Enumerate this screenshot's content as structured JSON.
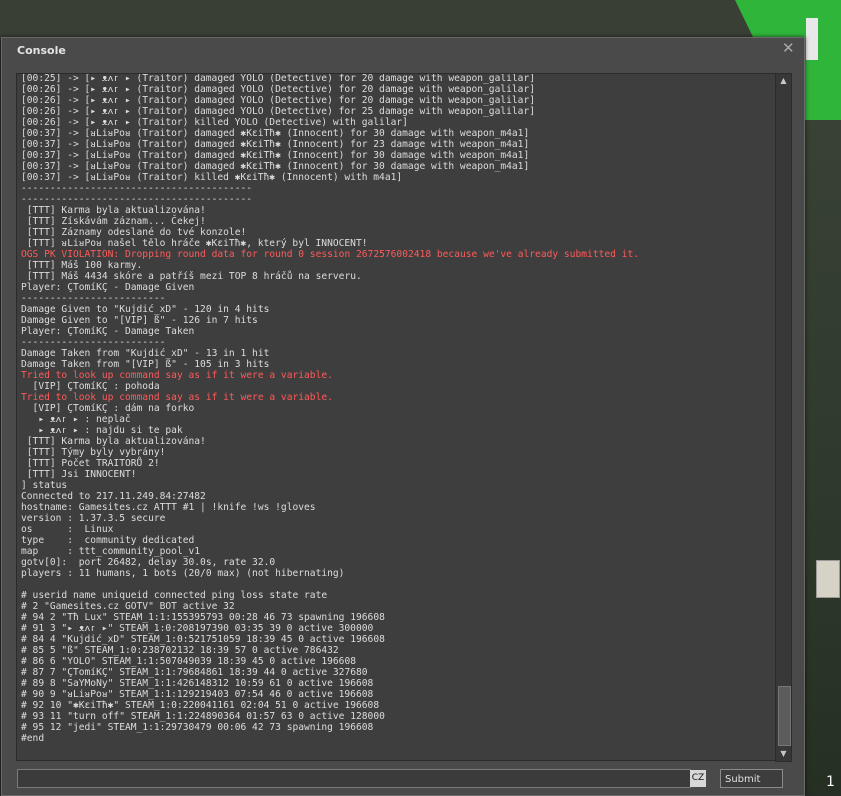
{
  "window": {
    "title": "Console",
    "close_glyph": "✕"
  },
  "colors": {
    "error": "#ff5a5a",
    "text": "#dcdcdc"
  },
  "console_lines": [
    {
      "text": "[00:25] -> [▸ ᴥᴧᴦ ▸ (Traitor) damaged YOLO (Detective) for 20 damage with weapon_galilar]",
      "type": "normal"
    },
    {
      "text": "[00:26] -> [▸ ᴥᴧᴦ ▸ (Traitor) damaged YOLO (Detective) for 20 damage with weapon_galilar]",
      "type": "normal"
    },
    {
      "text": "[00:26] -> [▸ ᴥᴧᴦ ▸ (Traitor) damaged YOLO (Detective) for 20 damage with weapon_galilar]",
      "type": "normal"
    },
    {
      "text": "[00:26] -> [▸ ᴥᴧᴦ ▸ (Traitor) damaged YOLO (Detective) for 25 damage with weapon_galilar]",
      "type": "normal"
    },
    {
      "text": "[00:26] -> [▸ ᴥᴧᴦ ▸ (Traitor) killed YOLO (Detective) with galilar]",
      "type": "normal"
    },
    {
      "text": "[00:37] -> [ᴚLiᴚPoᴚ (Traitor) damaged ✱KɛiTħ✱ (Innocent) for 30 damage with weapon_m4a1]",
      "type": "normal"
    },
    {
      "text": "[00:37] -> [ᴚLiᴚPoᴚ (Traitor) damaged ✱KɛiTħ✱ (Innocent) for 23 damage with weapon_m4a1]",
      "type": "normal"
    },
    {
      "text": "[00:37] -> [ᴚLiᴚPoᴚ (Traitor) damaged ✱KɛiTħ✱ (Innocent) for 30 damage with weapon_m4a1]",
      "type": "normal"
    },
    {
      "text": "[00:37] -> [ᴚLiᴚPoᴚ (Traitor) damaged ✱KɛiTħ✱ (Innocent) for 30 damage with weapon_m4a1]",
      "type": "normal"
    },
    {
      "text": "[00:37] -> [ᴚLiᴚPoᴚ (Traitor) killed ✱KɛiTħ✱ (Innocent) with m4a1]",
      "type": "normal"
    },
    {
      "text": "----------------------------------------",
      "type": "normal"
    },
    {
      "text": "----------------------------------------",
      "type": "normal"
    },
    {
      "text": " [TTT] Karma byla aktualizována!",
      "type": "normal"
    },
    {
      "text": " [TTT] Získávám záznam... Čekej!",
      "type": "normal"
    },
    {
      "text": " [TTT] Záznamy odeslané do tvé konzole!",
      "type": "normal"
    },
    {
      "text": " [TTT] ᴚLiᴚPoᴚ našel tělo hráče ✱KɛiTħ✱, který byl INNOCENT!",
      "type": "normal"
    },
    {
      "text": "OGS PK VIOLATION: Dropping round data for round 0 session 2672576002418 because we've already submitted it.",
      "type": "error"
    },
    {
      "text": " [TTT] Máš 100 karmy.",
      "type": "normal"
    },
    {
      "text": " [TTT] Máš 4434 skóre a patříš mezi TOP 8 hráčů na serveru.",
      "type": "normal"
    },
    {
      "text": "Player: ÇTomíKÇ - Damage Given",
      "type": "normal"
    },
    {
      "text": "-------------------------",
      "type": "normal"
    },
    {
      "text": "Damage Given to \"Kujdić_xD\" - 120 in 4 hits",
      "type": "normal"
    },
    {
      "text": "Damage Given to \"[VIP] ß\" - 126 in 7 hits",
      "type": "normal"
    },
    {
      "text": "Player: ÇTomíKÇ - Damage Taken",
      "type": "normal"
    },
    {
      "text": "-------------------------",
      "type": "normal"
    },
    {
      "text": "Damage Taken from \"Kujdić_xD\" - 13 in 1 hit",
      "type": "normal"
    },
    {
      "text": "Damage Taken from \"[VIP] ß\" - 105 in 3 hits",
      "type": "normal"
    },
    {
      "text": "Tried to look up command say as if it were a variable.",
      "type": "error"
    },
    {
      "text": "  [VIP] ÇTomíKÇ : pohoda",
      "type": "normal"
    },
    {
      "text": "Tried to look up command say as if it were a variable.",
      "type": "error"
    },
    {
      "text": "  [VIP] ÇTomíKÇ : dám na forko",
      "type": "normal"
    },
    {
      "text": "   ▸ ᴥᴧᴦ ▸ : neplač",
      "type": "normal"
    },
    {
      "text": "   ▸ ᴥᴧᴦ ▸ : najdu si te pak",
      "type": "normal"
    },
    {
      "text": " [TTT] Karma byla aktualizována!",
      "type": "normal"
    },
    {
      "text": " [TTT] Týmy byly vybrány!",
      "type": "normal"
    },
    {
      "text": " [TTT] Počet TRAITORŮ 2!",
      "type": "normal"
    },
    {
      "text": " [TTT] Jsi INNOCENT!",
      "type": "normal"
    },
    {
      "text": "] status",
      "type": "normal"
    },
    {
      "text": "Connected to 217.11.249.84:27482",
      "type": "normal"
    },
    {
      "text": "hostname: Gamesites.cz ATTT #1 | !knife !ws !gloves",
      "type": "normal"
    },
    {
      "text": "version : 1.37.3.5 secure",
      "type": "normal"
    },
    {
      "text": "os      :  Linux",
      "type": "normal"
    },
    {
      "text": "type    :  community dedicated",
      "type": "normal"
    },
    {
      "text": "map     : ttt_community_pool_v1",
      "type": "normal"
    },
    {
      "text": "gotv[0]:  port 26482, delay 30.0s, rate 32.0",
      "type": "normal"
    },
    {
      "text": "players : 11 humans, 1 bots (20/0 max) (not hibernating)",
      "type": "normal"
    },
    {
      "text": "",
      "type": "normal"
    },
    {
      "text": "# userid name uniqueid connected ping loss state rate",
      "type": "normal"
    },
    {
      "text": "# 2 \"Gamesites.cz GOTV\" BOT active 32",
      "type": "normal"
    },
    {
      "text": "# 94 2 \"Tħ Lux\" STEAM_1:1:155395793 00:28 46 73 spawning 196608",
      "type": "normal"
    },
    {
      "text": "# 91 3 \"▸ ᴥᴧᴦ ▸\" STEAM_1:0:208197390 03:35 39 0 active 300000",
      "type": "normal"
    },
    {
      "text": "# 84 4 \"Kujdić_xD\" STEAM_1:0:521751059 18:39 45 0 active 196608",
      "type": "normal"
    },
    {
      "text": "# 85 5 \"ß\" STEAM_1:0:238702132 18:39 57 0 active 786432",
      "type": "normal"
    },
    {
      "text": "# 86 6 \"YOLO\" STEAM_1:1:507049039 18:39 45 0 active 196608",
      "type": "normal"
    },
    {
      "text": "# 87 7 \"ÇTomíKÇ\" STEAM_1:1:79684861 18:39 44 0 active 327680",
      "type": "normal"
    },
    {
      "text": "# 89 8 \"SaYMoNy\" STEAM_1:1:426148312 10:59 61 0 active 196608",
      "type": "normal"
    },
    {
      "text": "# 90 9 \"ᴚLiᴚPoᴚ\" STEAM_1:1:129219403 07:54 46 0 active 196608",
      "type": "normal"
    },
    {
      "text": "# 92 10 \"✱KɛiTħ✱\" STEAM_1:0:220041161 02:04 51 0 active 196608",
      "type": "normal"
    },
    {
      "text": "# 93 11 \"turn off\" STEAM_1:1:224890364 01:57 63 0 active 128000",
      "type": "normal"
    },
    {
      "text": "# 95 12 \"jedi\" STEAM_1:1:29730479 00:06 42 73 spawning 196608",
      "type": "normal"
    },
    {
      "text": "#end",
      "type": "normal"
    }
  ],
  "input": {
    "value": "",
    "lang_badge": "CZ"
  },
  "buttons": {
    "submit": "Submit"
  },
  "scrollbar": {
    "up": "▲",
    "down": "▼"
  },
  "background": {
    "counter": "1"
  }
}
